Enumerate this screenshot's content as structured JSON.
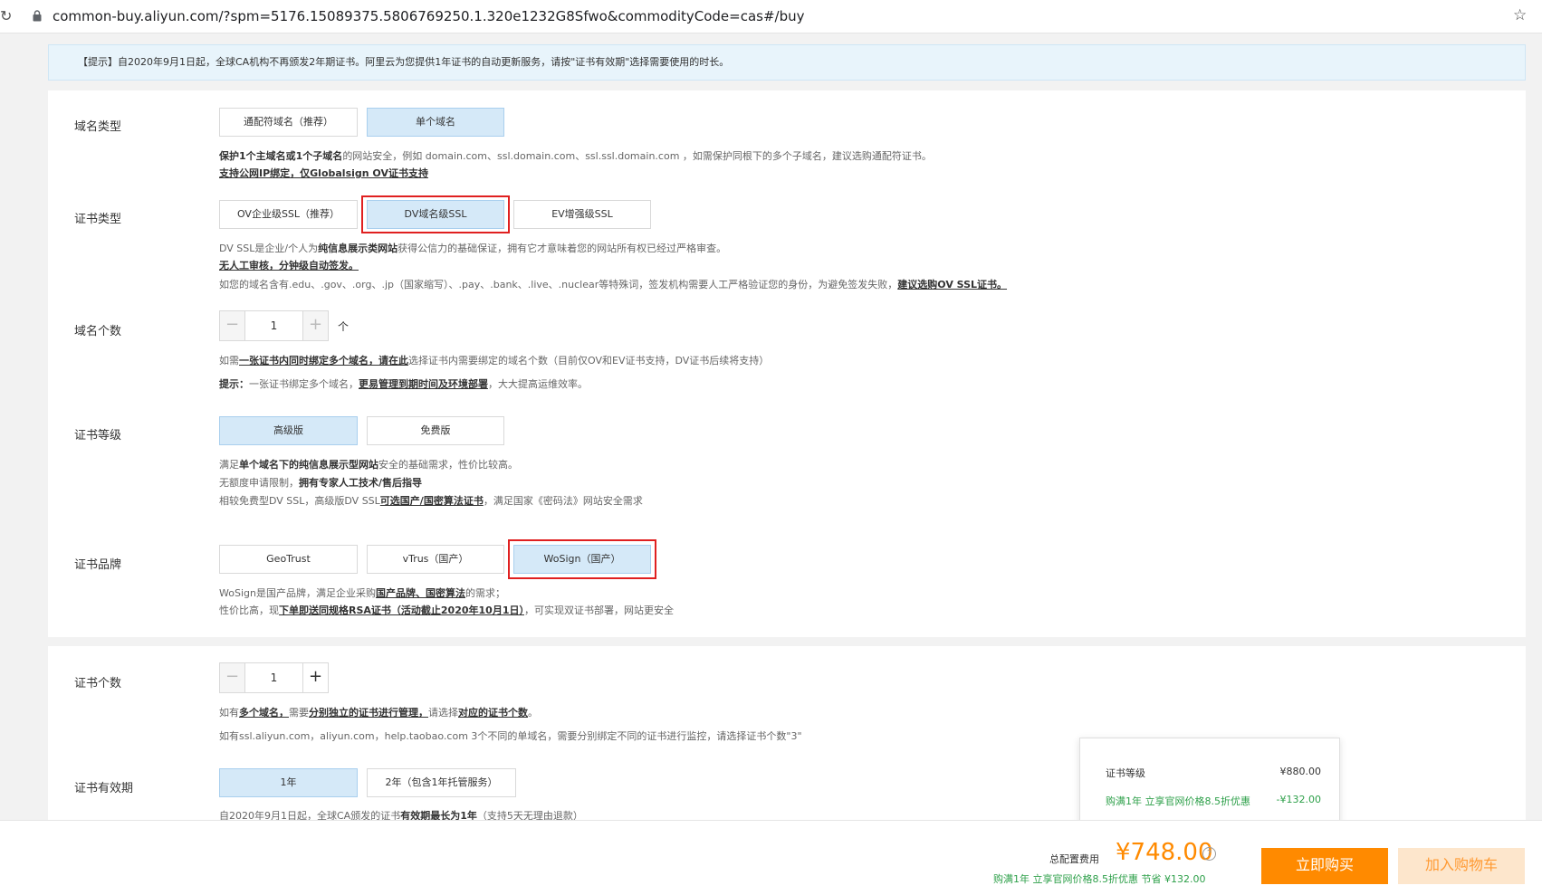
{
  "browser": {
    "url": "common-buy.aliyun.com/?spm=5176.15089375.5806769250.1.320e1232G8Sfwo&commodityCode=cas#/buy"
  },
  "notice": "【提示】自2020年9月1日起，全球CA机构不再颁发2年期证书。阿里云为您提供1年证书的自动更新服务，请按\"证书有效期\"选择需要使用的时长。",
  "domain_type": {
    "label": "域名类型",
    "options": [
      "通配符域名（推荐）",
      "单个域名"
    ],
    "selected": "单个域名",
    "desc1_a": "保护1个主域名或1个子域名",
    "desc1_b": "的网站安全，例如 domain.com、ssl.domain.com、ssl.ssl.domain.com ，如需保护同根下的多个子域名，建议选购通配符证书。",
    "desc2": "支持公网IP绑定，仅Globalsign OV证书支持"
  },
  "cert_type": {
    "label": "证书类型",
    "options": [
      "OV企业级SSL（推荐）",
      "DV域名级SSL",
      "EV增强级SSL"
    ],
    "selected": "DV域名级SSL",
    "desc1_a": "DV SSL是企业/个人为",
    "desc1_b": "纯信息展示类网站",
    "desc1_c": "获得公信力的基础保证，拥有它才意味着您的网站所有权已经过严格审查。",
    "desc2": "无人工审核，分钟级自动签发。",
    "desc3_a": "如您的域名含有.edu、.gov、.org、.jp（国家缩写）、.pay、.bank、.live、.nuclear等特殊词，签发机构需要人工严格验证您的身份，为避免签发失败，",
    "desc3_b": "建议选购OV SSL证书。"
  },
  "domain_count": {
    "label": "域名个数",
    "value": "1",
    "unit": "个",
    "desc1_a": "如需",
    "desc1_b": "一张证书内同时绑定多个域名，请在此",
    "desc1_c": "选择证书内需要绑定的域名个数（目前仅OV和EV证书支持，DV证书后续将支持）",
    "desc2_a": "提示：",
    "desc2_b": "一张证书绑定多个域名，",
    "desc2_c": "更易管理到期时间及环境部署",
    "desc2_d": "，大大提高运维效率。"
  },
  "cert_level": {
    "label": "证书等级",
    "options": [
      "高级版",
      "免费版"
    ],
    "selected": "高级版",
    "desc1_a": "满足",
    "desc1_b": "单个域名下的纯信息展示型网站",
    "desc1_c": "安全的基础需求，性价比较高。",
    "desc2_a": "无额度申请限制，",
    "desc2_b": "拥有专家人工技术/售后指导",
    "desc3_a": "相较免费型DV SSL，高级版DV SSL",
    "desc3_b": "可选国产/国密算法证书",
    "desc3_c": "，满足国家《密码法》网站安全需求"
  },
  "cert_brand": {
    "label": "证书品牌",
    "options": [
      "GeoTrust",
      "vTrus（国产）",
      "WoSign（国产）"
    ],
    "selected": "WoSign（国产）",
    "desc1_a": "WoSign是国产品牌，满足企业采购",
    "desc1_b": "国产品牌、国密算法",
    "desc1_c": "的需求；",
    "desc2_a": "性价比高，现",
    "desc2_b": "下单即送同规格RSA证书（活动截止2020年10月1日）",
    "desc2_c": "，可实现双证书部署，网站更安全"
  },
  "cert_count": {
    "label": "证书个数",
    "value": "1",
    "desc1_a": "如有",
    "desc1_b": "多个域名，",
    "desc1_c": "需要",
    "desc1_d": "分别独立的证书进行管理，",
    "desc1_e": "请选择",
    "desc1_f": "对应的证书个数",
    "desc1_g": "。",
    "desc2": "如有ssl.aliyun.com，aliyun.com，help.taobao.com 3个不同的单域名，需要分别绑定不同的证书进行监控，请选择证书个数\"3\""
  },
  "validity": {
    "label": "证书有效期",
    "options": [
      "1年",
      "2年（包含1年托管服务）"
    ],
    "selected": "1年",
    "desc_a": "自2020年9月1日起，全球CA颁发的证书",
    "desc_b": "有效期最长为1年",
    "desc_c": "（支持5天无理由退款）"
  },
  "popup": {
    "level_label": "证书等级",
    "level_price": "¥880.00",
    "discount_label": "购满1年 立享官网价格8.5折优惠",
    "discount_value": "-¥132.00"
  },
  "footer": {
    "total_label": "总配置费用",
    "total_price": "¥748.00",
    "help_icon": "?",
    "saving": "购满1年 立享官网价格8.5折优惠 节省 ¥132.00",
    "buy_label": "立即购买",
    "cart_label": "加入购物车"
  },
  "colors": {
    "accent_orange": "#ff8a00",
    "selected_bg": "#d5e9f8",
    "highlight_red": "#e02020",
    "discount_green": "#2ea04a"
  }
}
